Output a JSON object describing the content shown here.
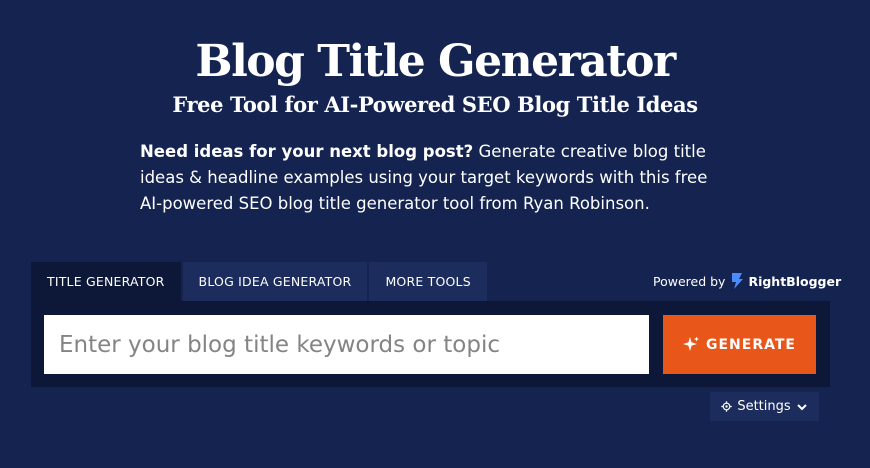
{
  "header": {
    "title": "Blog Title Generator",
    "subtitle": "Free Tool for AI-Powered SEO Blog Title Ideas",
    "intro_bold": "Need ideas for your next blog post?",
    "intro_text": " Generate creative blog title ideas & headline examples using your target keywords with this free AI-powered SEO blog title generator tool from Ryan Robinson."
  },
  "tabs": [
    {
      "label": "TITLE GENERATOR",
      "active": true
    },
    {
      "label": "BLOG IDEA GENERATOR",
      "active": false
    },
    {
      "label": "MORE TOOLS",
      "active": false
    }
  ],
  "powered": {
    "label": "Powered by",
    "brand": "RightBlogger",
    "icon": "rightblogger-logo-icon"
  },
  "search": {
    "placeholder": "Enter your blog title keywords or topic",
    "value": ""
  },
  "generate": {
    "label": "GENERATE",
    "icon": "sparkle-icon"
  },
  "settings": {
    "label": "Settings",
    "icon": "gear-icon",
    "chevron": "chevron-down-icon"
  },
  "colors": {
    "background": "#142350",
    "panel": "#0d1838",
    "tab_inactive": "#1c2c5c",
    "accent": "#e8561a",
    "brand_icon": "#4a8cff"
  }
}
